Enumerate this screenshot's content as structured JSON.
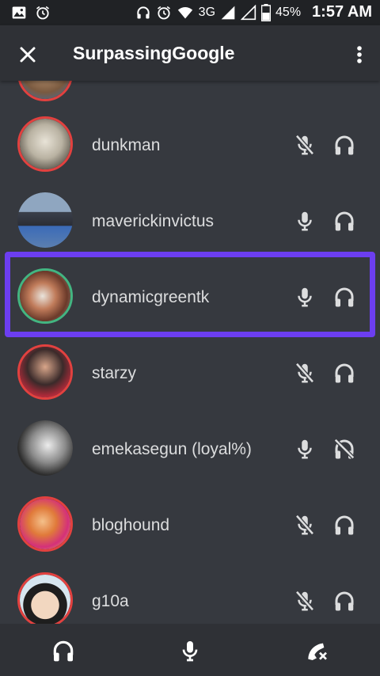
{
  "status_bar": {
    "network": "3G",
    "battery": "45%",
    "time": "1:57 AM",
    "icons": [
      "image-icon",
      "alarm-icon",
      "headphones-icon",
      "alarm-icon",
      "wifi-icon",
      "signal-icon",
      "signal-icon",
      "battery-icon"
    ]
  },
  "header": {
    "title": "SurpassingGoogle",
    "close_icon": "close-icon",
    "more_icon": "more-vert-icon"
  },
  "members": [
    {
      "name": "dunkman",
      "ring": "red",
      "mic": "muted",
      "headphones": "on"
    },
    {
      "name": "maverickinvictus",
      "ring": "none",
      "mic": "on",
      "headphones": "on"
    },
    {
      "name": "dynamicgreentk",
      "ring": "green",
      "mic": "on",
      "headphones": "on",
      "highlighted": true
    },
    {
      "name": "starzy",
      "ring": "red",
      "mic": "muted",
      "headphones": "on"
    },
    {
      "name": "emekasegun (loyal%)",
      "ring": "none",
      "mic": "on",
      "headphones": "deafened"
    },
    {
      "name": "bloghound",
      "ring": "red",
      "mic": "muted",
      "headphones": "on"
    },
    {
      "name": "g10a",
      "ring": "red",
      "mic": "muted",
      "headphones": "on"
    }
  ],
  "bottom_bar": {
    "buttons": [
      "headphones-icon",
      "microphone-icon",
      "disconnect-call-icon"
    ]
  },
  "colors": {
    "background": "#36393f",
    "header": "#2f3136",
    "status_bar": "#202225",
    "speaking_ring": "#43b581",
    "status_ring": "#e2413f",
    "highlight": "#6c3ef0"
  }
}
